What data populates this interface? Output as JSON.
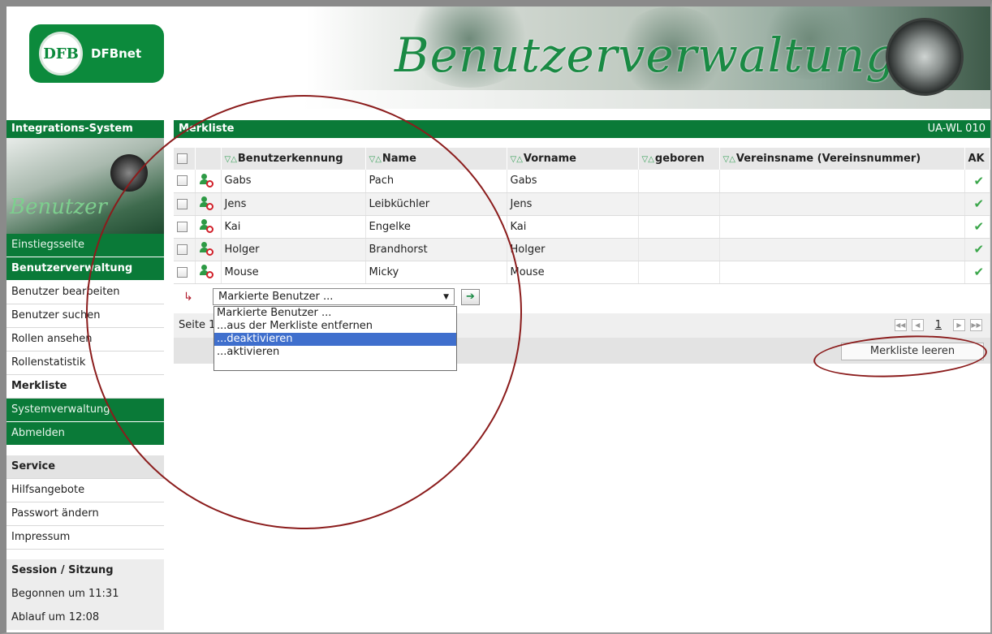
{
  "header": {
    "logo_text": "DFBnet",
    "logo_emblem": "DFB",
    "title": "Benutzerverwaltung"
  },
  "sidebar": {
    "heading": "Integrations-System",
    "photo_text": "Benutzer",
    "items": [
      {
        "label": "Einstiegsseite"
      },
      {
        "label": "Benutzerverwaltung"
      },
      {
        "label": "Benutzer bearbeiten"
      },
      {
        "label": "Benutzer suchen"
      },
      {
        "label": "Rollen ansehen"
      },
      {
        "label": "Rollenstatistik"
      },
      {
        "label": "Merkliste"
      },
      {
        "label": "Systemverwaltung"
      },
      {
        "label": "Abmelden"
      }
    ],
    "service": {
      "heading": "Service",
      "items": [
        {
          "label": "Hilfsangebote"
        },
        {
          "label": "Passwort ändern"
        },
        {
          "label": "Impressum"
        }
      ]
    },
    "session": {
      "heading": "Session / Sitzung",
      "started": "Begonnen um 11:31",
      "expires": "Ablauf um 12:08"
    }
  },
  "main": {
    "title": "Merkliste",
    "code": "UA-WL 010",
    "sort_symbol": "▽△",
    "columns": [
      "Benutzerkennung",
      "Name",
      "Vorname",
      "geboren",
      "Vereinsname (Vereinsnummer)",
      "AK"
    ],
    "rows": [
      {
        "kennung": "Gabs",
        "name": "Pach",
        "vorname": "Gabs",
        "geboren": "",
        "verein": "",
        "ak": "✔"
      },
      {
        "kennung": "Jens",
        "name": "Leibküchler",
        "vorname": "Jens",
        "geboren": "",
        "verein": "",
        "ak": "✔"
      },
      {
        "kennung": "Kai",
        "name": "Engelke",
        "vorname": "Kai",
        "geboren": "",
        "verein": "",
        "ak": "✔"
      },
      {
        "kennung": "Holger",
        "name": "Brandhorst",
        "vorname": "Holger",
        "geboren": "",
        "verein": "",
        "ak": "✔"
      },
      {
        "kennung": "Mouse",
        "name": "Micky",
        "vorname": "Mouse",
        "geboren": "",
        "verein": "",
        "ak": "✔"
      }
    ],
    "action_select": {
      "value": "Markierte Benutzer ...",
      "options": [
        "Markierte Benutzer ...",
        "...aus der Merkliste entfernen",
        "...deaktivieren",
        "...aktivieren"
      ],
      "highlighted_index": 2
    },
    "go_symbol": "➔",
    "pager": {
      "label": "Seite 1",
      "current": "1"
    },
    "clear_button": "Merkliste leeren"
  }
}
